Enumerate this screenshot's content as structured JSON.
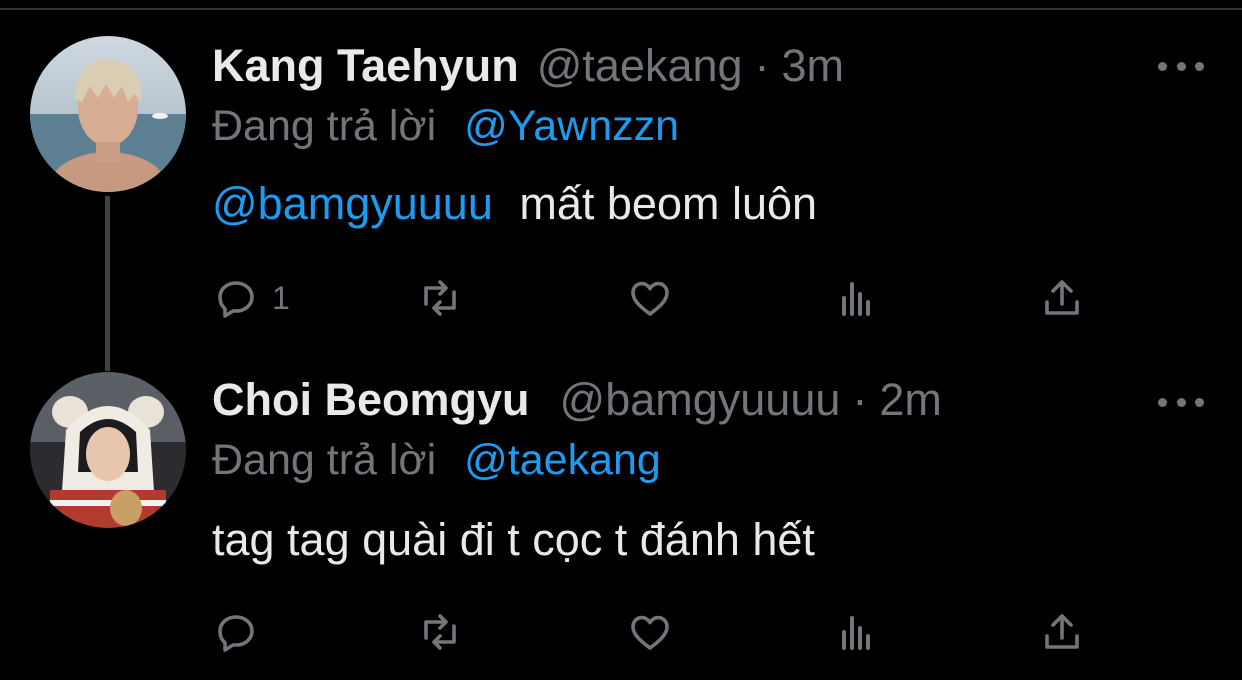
{
  "colors": {
    "background": "#000000",
    "text_primary": "#e7e9ea",
    "text_secondary": "#71767b",
    "link": "#1d9bf0"
  },
  "tweets": [
    {
      "display_name": "Kang Taehyun",
      "handle": "@taekang",
      "separator": "·",
      "time": "3m",
      "reply_prefix": "Đang trả lời",
      "reply_to": "@Yawnzzn",
      "mention": "@bamgyuuuu",
      "text": "mất beom luôn",
      "reply_count": "1",
      "icons": [
        "reply-icon",
        "retweet-icon",
        "like-icon",
        "views-icon",
        "share-icon",
        "more-icon"
      ]
    },
    {
      "display_name": "Choi Beomgyu",
      "handle": "@bamgyuuuu",
      "separator": "·",
      "time": "2m",
      "reply_prefix": "Đang trả lời",
      "reply_to": "@taekang",
      "text": "tag tag quài đi t cọc t đánh hết",
      "reply_count": "",
      "icons": [
        "reply-icon",
        "retweet-icon",
        "like-icon",
        "views-icon",
        "share-icon",
        "more-icon"
      ]
    }
  ]
}
